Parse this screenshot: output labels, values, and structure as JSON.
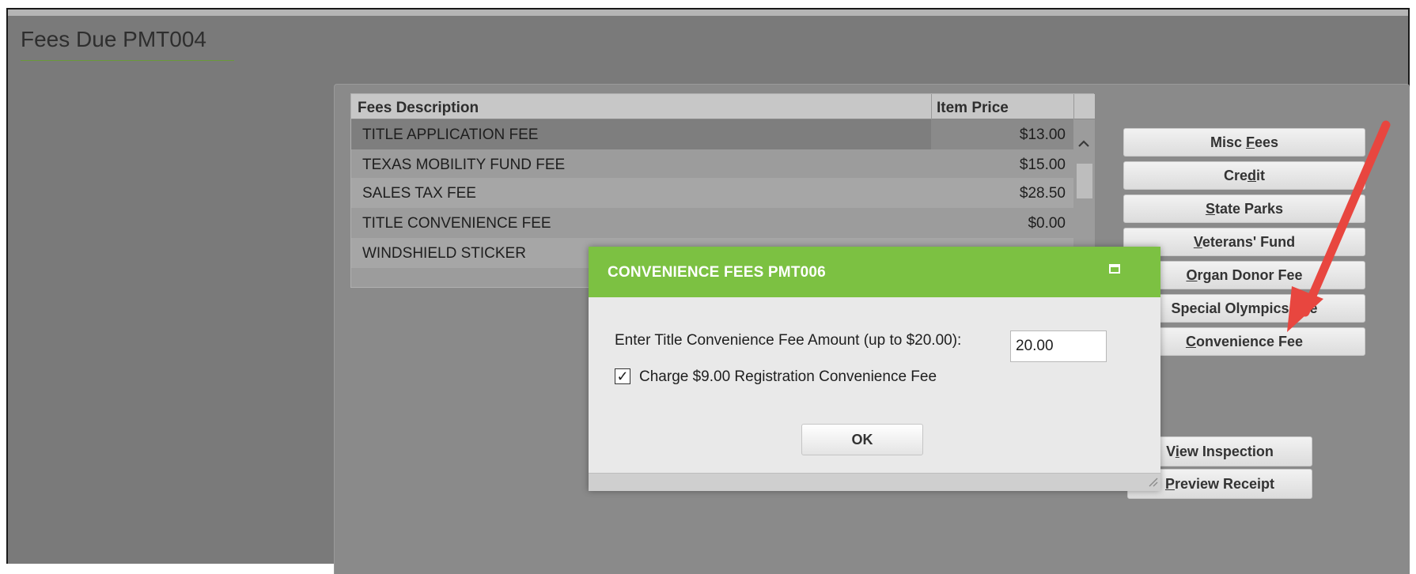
{
  "page": {
    "title": "Fees Due PMT004"
  },
  "grid": {
    "columns": [
      "Fees Description",
      "Item Price"
    ],
    "rows": [
      {
        "description": "TITLE APPLICATION FEE",
        "price": "$13.00"
      },
      {
        "description": "TEXAS MOBILITY FUND FEE",
        "price": "$15.00"
      },
      {
        "description": "SALES TAX FEE",
        "price": "$28.50"
      },
      {
        "description": "TITLE CONVENIENCE FEE",
        "price": "$0.00"
      },
      {
        "description": "WINDSHIELD STICKER",
        "price": ""
      }
    ]
  },
  "side_buttons": [
    {
      "pre": "Misc ",
      "key": "F",
      "post": "ees"
    },
    {
      "pre": "Cre",
      "key": "d",
      "post": "it"
    },
    {
      "pre": "",
      "key": "S",
      "post": "tate Parks"
    },
    {
      "pre": "",
      "key": "V",
      "post": "eterans' Fund"
    },
    {
      "pre": "",
      "key": "O",
      "post": "rgan Donor Fee"
    },
    {
      "pre": "Special Olympics ",
      "key": "",
      "post": "Fee"
    },
    {
      "pre": "",
      "key": "C",
      "post": "onvenience Fee"
    }
  ],
  "lower_buttons": [
    {
      "pre": "V",
      "key": "i",
      "post": "ew Inspection"
    },
    {
      "pre": "",
      "key": "P",
      "post": "review Receipt"
    }
  ],
  "dialog": {
    "title": "CONVENIENCE FEES PMT006",
    "fee_label": "Enter Title Convenience Fee Amount (up to $20.00):",
    "fee_value": "20.00",
    "checkbox_checked": "✓",
    "checkbox_pre": "Char",
    "checkbox_key": "g",
    "checkbox_post": "e $9.00 Registration Convenience Fee",
    "ok_label": "OK"
  },
  "colors": {
    "accent": "#7cc142",
    "arrow": "#e8463f"
  },
  "icons": {
    "scroll_up": "chevron-up-icon",
    "maximize": "maximize-icon",
    "resize": "resize-grip-icon",
    "annotation": "red-arrow"
  }
}
